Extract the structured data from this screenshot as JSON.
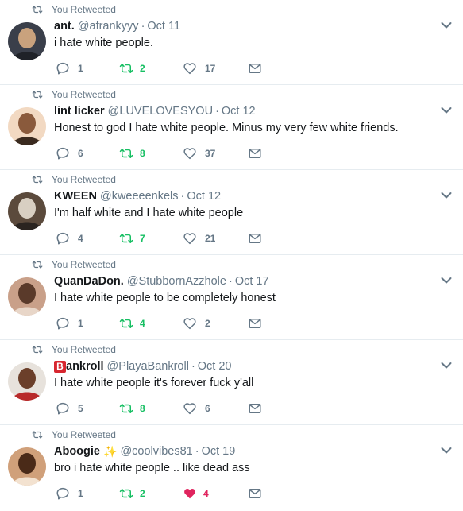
{
  "retweet_label": "You Retweeted",
  "tweets": [
    {
      "name": "ant.",
      "handle": "@afrankyyy",
      "date": "Oct 11",
      "text": "i hate white people.",
      "replies": "1",
      "retweets": "2",
      "likes": "17",
      "liked": false
    },
    {
      "name": "lint licker",
      "handle": "@LUVELOVESYOU",
      "date": "Oct 12",
      "text": "Honest to god I hate white people. Minus my very few white friends.",
      "replies": "6",
      "retweets": "8",
      "likes": "37",
      "liked": false
    },
    {
      "name": "KWEEN",
      "handle": "@kweeeenkels",
      "date": "Oct 12",
      "text": "I'm half white and I hate white people",
      "replies": "4",
      "retweets": "7",
      "likes": "21",
      "liked": false
    },
    {
      "name": "QuanDaDon.",
      "handle": "@StubbornAzzhole",
      "date": "Oct 17",
      "text": "I hate white people to be completely honest",
      "replies": "1",
      "retweets": "4",
      "likes": "2",
      "liked": false
    },
    {
      "name_badge": "B",
      "name": "ankroll",
      "handle": "@PlayaBankroll",
      "date": "Oct 20",
      "text": "I hate white people it's forever fuck y'all",
      "replies": "5",
      "retweets": "8",
      "likes": "6",
      "liked": false
    },
    {
      "name": "Aboogie",
      "handle": "@coolvibes81",
      "date": "Oct 19",
      "text": "bro i hate white people .. like dead ass",
      "replies": "1",
      "retweets": "2",
      "likes": "4",
      "liked": true
    }
  ],
  "colors": {
    "text_primary": "#14171a",
    "text_secondary": "#657786",
    "retweet_green": "#17bf63",
    "like_red": "#e0245e",
    "divider": "#e6ecf0"
  },
  "icons": {
    "retweet": "retweet-icon",
    "reply": "reply-icon",
    "like": "heart-icon",
    "dm": "envelope-icon",
    "more": "chevron-down-icon"
  }
}
